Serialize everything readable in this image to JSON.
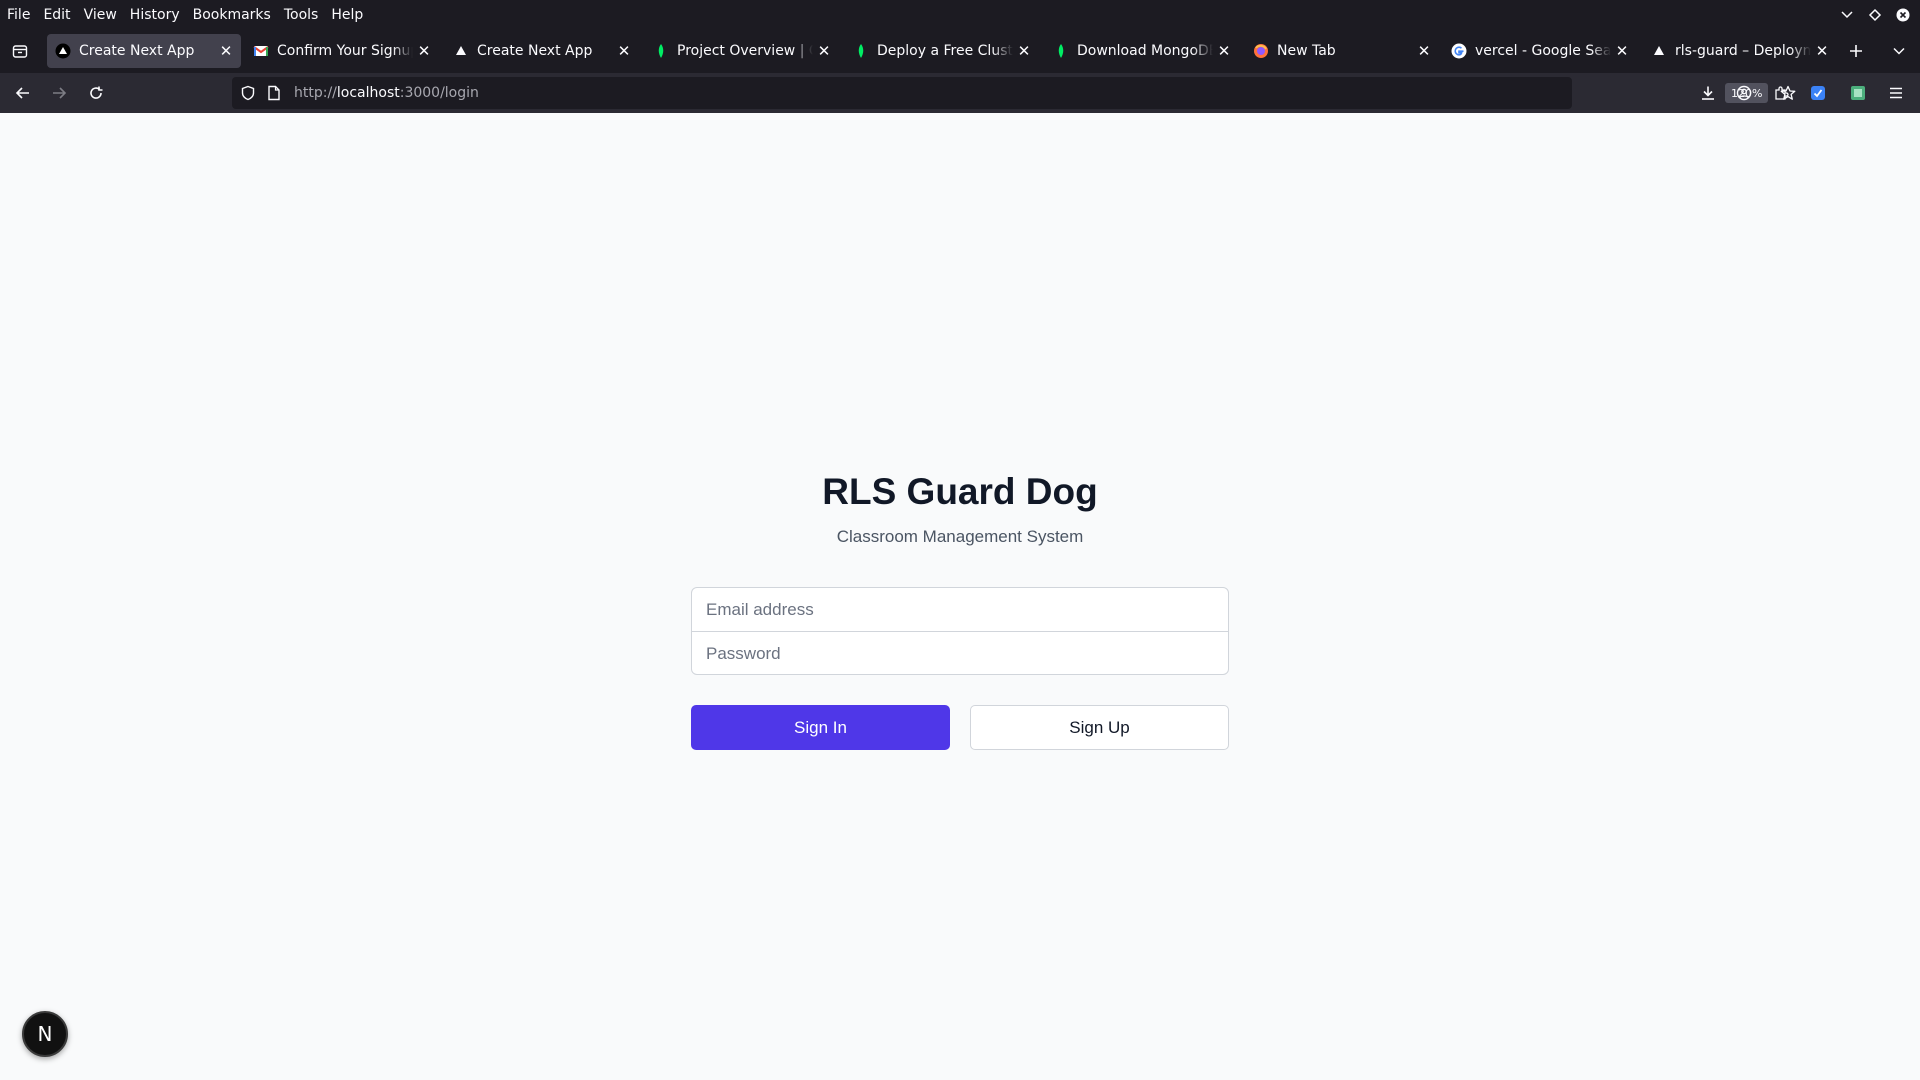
{
  "menubar": {
    "items": [
      {
        "label": "File"
      },
      {
        "label": "Edit"
      },
      {
        "label": "View"
      },
      {
        "label": "History"
      },
      {
        "label": "Bookmarks"
      },
      {
        "label": "Tools"
      },
      {
        "label": "Help"
      }
    ]
  },
  "tabs": [
    {
      "title": "Create Next App",
      "icon": "vercel-triangle-icon",
      "active": true
    },
    {
      "title": "Confirm Your Signup - ",
      "icon": "gmail-icon",
      "active": false
    },
    {
      "title": "Create Next App",
      "icon": "vercel-triangle-icon",
      "active": false
    },
    {
      "title": "Project Overview | Clou",
      "icon": "mongodb-leaf-icon",
      "active": false
    },
    {
      "title": "Deploy a Free Cluster - ",
      "icon": "mongodb-leaf-icon",
      "active": false
    },
    {
      "title": "Download MongoDB A",
      "icon": "mongodb-leaf-icon",
      "active": false
    },
    {
      "title": "New Tab",
      "icon": "firefox-icon",
      "active": false
    },
    {
      "title": "vercel - Google Search",
      "icon": "google-icon",
      "active": false
    },
    {
      "title": "rls-guard – Deploymen",
      "icon": "vercel-triangle-icon",
      "active": false
    }
  ],
  "navbar": {
    "url_scheme": "http://",
    "url_host": "localhost",
    "url_path": ":3000/login",
    "zoom": "120%"
  },
  "page": {
    "title": "RLS Guard Dog",
    "subtitle": "Classroom Management System",
    "email_placeholder": "Email address",
    "password_placeholder": "Password",
    "sign_in_label": "Sign In",
    "sign_up_label": "Sign Up",
    "next_badge_letter": "N"
  },
  "colors": {
    "primary_button": "#4f37e8",
    "page_background": "#f9fafb",
    "browser_chrome": "#1c1b22"
  }
}
